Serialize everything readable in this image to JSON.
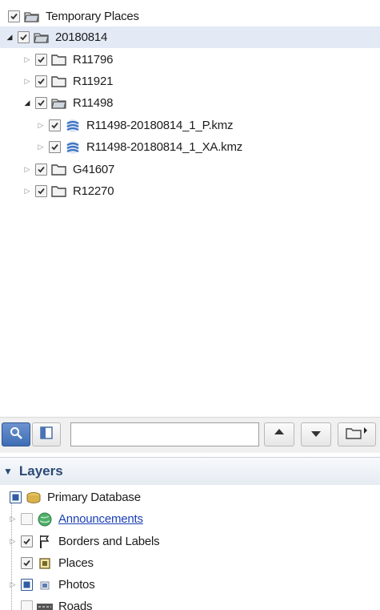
{
  "places": {
    "items": [
      {
        "label": "Temporary Places",
        "icon": "folder-open-icon",
        "checked": true
      },
      {
        "label": "20180814",
        "icon": "folder-open-icon",
        "checked": true,
        "selected": true
      },
      {
        "label": "R11796",
        "icon": "folder-icon",
        "checked": true
      },
      {
        "label": "R11921",
        "icon": "folder-icon",
        "checked": true
      },
      {
        "label": "R11498",
        "icon": "folder-open-icon",
        "checked": true
      },
      {
        "label": "R11498-20180814_1_P.kmz",
        "icon": "kmz-network-icon",
        "checked": true
      },
      {
        "label": "R11498-20180814_1_XA.kmz",
        "icon": "kmz-network-icon",
        "checked": true
      },
      {
        "label": "G41607",
        "icon": "folder-icon",
        "checked": true
      },
      {
        "label": "R12270",
        "icon": "folder-icon",
        "checked": true
      }
    ]
  },
  "toolbar": {
    "search_placeholder": "",
    "buttons": [
      "search-tab-icon",
      "panel-toggle-icon",
      "move-up-icon",
      "move-down-icon",
      "new-folder-icon"
    ]
  },
  "layers": {
    "header": "Layers",
    "items": [
      {
        "label": "Primary Database",
        "icon": "database-icon",
        "checked": "partial"
      },
      {
        "label": "Announcements",
        "icon": "globe-icon",
        "checked": false,
        "link": true
      },
      {
        "label": "Borders and Labels",
        "icon": "flag-icon",
        "checked": true
      },
      {
        "label": "Places",
        "icon": "places-icon",
        "checked": true
      },
      {
        "label": "Photos",
        "icon": "photo-icon",
        "checked": "partial"
      },
      {
        "label": "Roads",
        "icon": "roads-icon",
        "checked": false
      }
    ]
  },
  "colors": {
    "selected_row": "#e3eaf5",
    "layers_header_text": "#2b4a75",
    "link": "#1b3fb5"
  }
}
